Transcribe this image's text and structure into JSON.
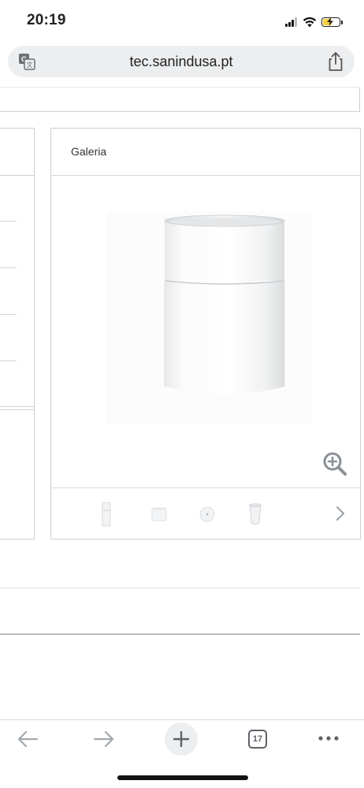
{
  "status_bar": {
    "time": "20:19",
    "battery_level": 0.6,
    "battery_color": "#f5d33c",
    "icons": [
      "signal-icon",
      "wifi-icon",
      "battery-charging-icon"
    ]
  },
  "browser": {
    "url": "tec.sanindusa.pt",
    "translate_icon": "translate-icon",
    "share_icon": "share-icon"
  },
  "gallery": {
    "title": "Galeria",
    "zoom_icon": "zoom-in-icon",
    "next_icon": "chevron-right-icon",
    "thumbnails": [
      "tall-washbasin-thumbnail",
      "short-basin-thumbnail",
      "top-view-thumbnail",
      "angled-washbasin-thumbnail"
    ]
  },
  "toolbar": {
    "back_icon": "back-arrow-icon",
    "forward_icon": "forward-arrow-icon",
    "new_tab_icon": "plus-icon",
    "tab_count": "17",
    "menu_icon": "more-dots-icon"
  }
}
